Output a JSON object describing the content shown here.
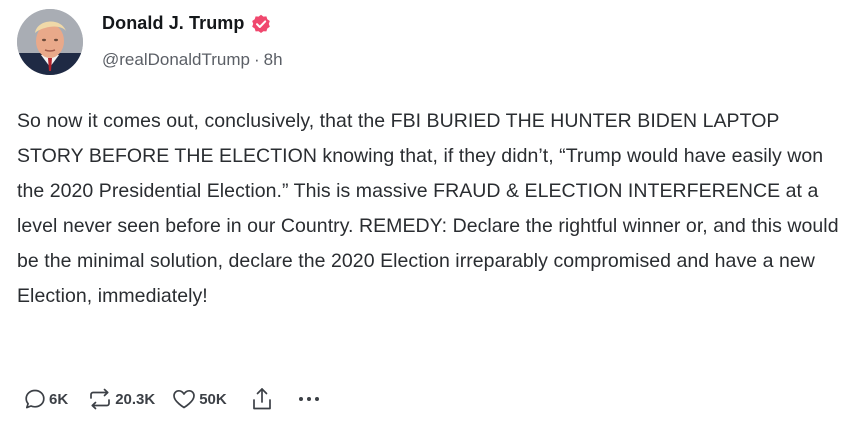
{
  "author": {
    "display_name": "Donald J. Trump",
    "handle": "@realDonaldTrump",
    "separator": "·",
    "time_ago": "8h",
    "verified_badge_color": "#f0486e"
  },
  "post": {
    "text": "So now it comes out, conclusively, that the FBI BURIED THE HUNTER BIDEN LAPTOP STORY BEFORE THE ELECTION knowing that, if they didn’t, “Trump would have easily won the 2020 Presidential Election.” This is massive FRAUD & ELECTION INTERFERENCE at a  level never seen before in our Country. REMEDY: Declare the rightful winner or, and this would be the minimal solution, declare the 2020 Election irreparably compromised and have a new Election, immediately!"
  },
  "actions": {
    "replies": "6K",
    "reposts": "20.3K",
    "likes": "50K",
    "icons": [
      "reply-icon",
      "repost-icon",
      "like-icon",
      "share-icon",
      "more-icon"
    ]
  },
  "colors": {
    "text": "#2a2d31",
    "muted": "#5b5f66",
    "icon": "#3c4046",
    "background": "#ffffff"
  }
}
